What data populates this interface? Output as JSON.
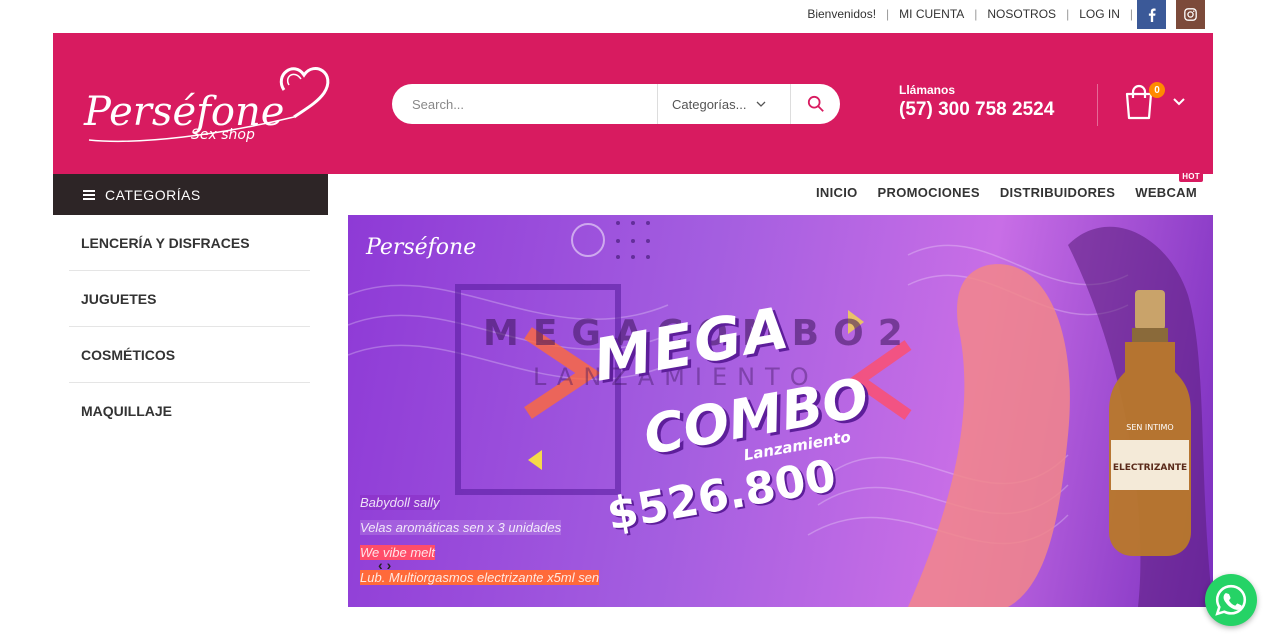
{
  "topbar": {
    "links": [
      "Bienvenidos!",
      "MI CUENTA",
      "NOSOTROS",
      "LOG IN"
    ],
    "social": [
      "facebook-icon",
      "instagram-icon"
    ]
  },
  "header": {
    "logo_name": "Perséfone",
    "logo_sub": "Sex shop",
    "search_placeholder": "Search...",
    "category_select": "Categorías...",
    "call_label": "Llámanos",
    "phone": "(57) 300 758 2524",
    "cart_count": "0",
    "brand_color": "#d81b60"
  },
  "sidebar": {
    "header": "CATEGORÍAS",
    "items": [
      {
        "label": "LENCERÍA Y DISFRACES"
      },
      {
        "label": "JUGUETES"
      },
      {
        "label": "COSMÉTICOS"
      },
      {
        "label": "MAQUILLAJE"
      }
    ]
  },
  "nav": {
    "items": [
      {
        "label": "INICIO"
      },
      {
        "label": "PROMOCIONES"
      },
      {
        "label": "DISTRIBUIDORES"
      },
      {
        "label": "WEBCAM",
        "badge": "HOT"
      }
    ]
  },
  "banner": {
    "logo": "Perséfone",
    "ghost_title": "MEGACOMBO2",
    "ghost_sub": "LANZAMIENTO",
    "title1": "MEGA",
    "title2": "COMBO",
    "subtitle": "Lanzamiento",
    "price": "$526.800",
    "products": [
      "Babydoll sally",
      "Velas aromáticas sen x 3 unidades",
      "We vibe melt",
      "Lub. Multiorgasmos electrizante x5ml sen"
    ],
    "bottle_brand": "SEN INTIMO",
    "bottle_label": "ELECTRIZANTE"
  }
}
